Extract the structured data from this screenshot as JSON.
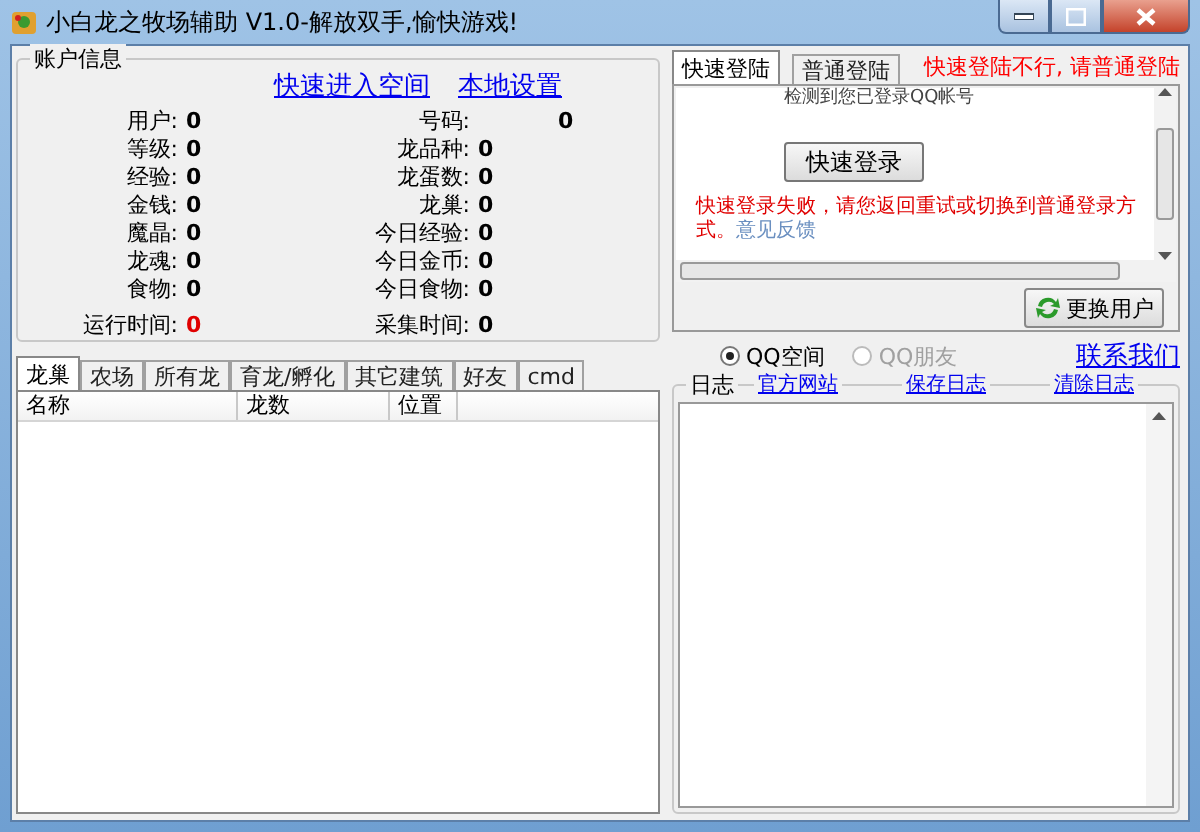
{
  "window": {
    "title": "小白龙之牧场辅助 V1.0-解放双手,愉快游戏!"
  },
  "account": {
    "title": "账户信息",
    "links": [
      "快速进入空间",
      "本地设置"
    ],
    "left_fields": [
      {
        "label": "用户:",
        "value": "0",
        "highlight": false
      },
      {
        "label": "等级:",
        "value": "0",
        "highlight": false
      },
      {
        "label": "经验:",
        "value": "0",
        "highlight": false
      },
      {
        "label": "金钱:",
        "value": "0",
        "highlight": false
      },
      {
        "label": "魔晶:",
        "value": "0",
        "highlight": false
      },
      {
        "label": "龙魂:",
        "value": "0",
        "highlight": false
      },
      {
        "label": "食物:",
        "value": "0",
        "highlight": false
      },
      {
        "label": "运行时间:",
        "value": "0",
        "highlight": true
      }
    ],
    "right_fields": [
      {
        "label": "号码:",
        "value": "0",
        "highlight": false
      },
      {
        "label": "龙品种:",
        "value": "0",
        "highlight": false
      },
      {
        "label": "龙蛋数:",
        "value": "0",
        "highlight": false
      },
      {
        "label": "龙巢:",
        "value": "0",
        "highlight": false
      },
      {
        "label": "今日经验:",
        "value": "0",
        "highlight": false
      },
      {
        "label": "今日金币:",
        "value": "0",
        "highlight": false
      },
      {
        "label": "今日食物:",
        "value": "0",
        "highlight": false
      },
      {
        "label": "采集时间:",
        "value": "0",
        "highlight": false
      }
    ]
  },
  "login": {
    "tabs": [
      {
        "label": "快速登陆",
        "selected": true
      },
      {
        "label": "普通登陆",
        "selected": false
      }
    ],
    "notice": "快速登陆不行, 请普通登陆",
    "top_text": "检测到您已登录QQ帐号",
    "button": "快速登录",
    "error": "快速登录失败，请您返回重试或切换到普通登录方式。",
    "feedback_link": "意见反馈",
    "switch_button": "更换用户"
  },
  "targets": {
    "options": [
      {
        "label": "QQ空间",
        "selected": true,
        "disabled": false
      },
      {
        "label": "QQ朋友",
        "selected": false,
        "disabled": true
      }
    ],
    "contact_link": "联系我们"
  },
  "bottom_tabs": [
    {
      "label": "龙巢",
      "selected": true
    },
    {
      "label": "农场",
      "selected": false
    },
    {
      "label": "所有龙",
      "selected": false
    },
    {
      "label": "育龙/孵化",
      "selected": false
    },
    {
      "label": "其它建筑",
      "selected": false
    },
    {
      "label": "好友",
      "selected": false
    },
    {
      "label": "cmd",
      "selected": false
    }
  ],
  "table": {
    "columns": [
      "名称",
      "龙数",
      "位置"
    ]
  },
  "log": {
    "title": "日志",
    "links": [
      "官方网站",
      "保存日志",
      "清除日志"
    ]
  }
}
